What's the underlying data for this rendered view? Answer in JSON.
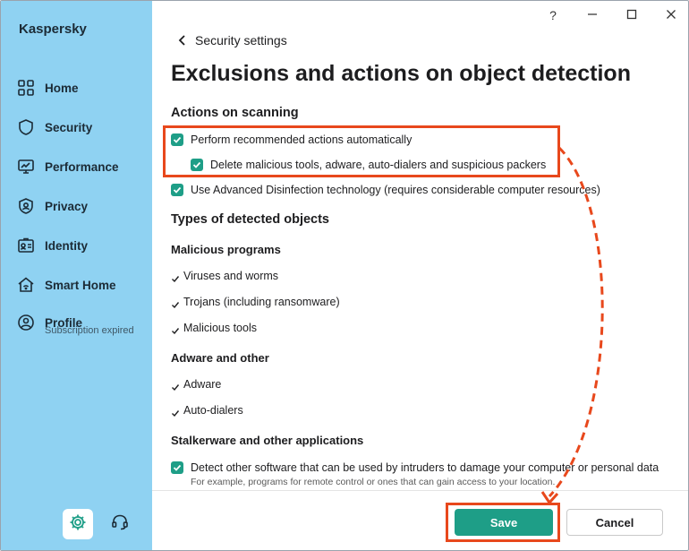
{
  "app": {
    "brand": "Kaspersky"
  },
  "window_controls": {
    "help": "?",
    "minimize": "—",
    "maximize": "☐",
    "close": "✕"
  },
  "sidebar": {
    "items": [
      {
        "label": "Home",
        "icon": "home-icon"
      },
      {
        "label": "Security",
        "icon": "shield-icon"
      },
      {
        "label": "Performance",
        "icon": "performance-icon"
      },
      {
        "label": "Privacy",
        "icon": "privacy-icon"
      },
      {
        "label": "Identity",
        "icon": "identity-icon"
      },
      {
        "label": "Smart Home",
        "icon": "smart-home-icon"
      },
      {
        "label": "Profile",
        "icon": "profile-icon",
        "sublabel": "Subscription expired"
      }
    ]
  },
  "header": {
    "back_label": "Security settings",
    "title": "Exclusions and actions on object detection"
  },
  "actions_on_scanning": {
    "title": "Actions on scanning",
    "options": [
      {
        "label": "Perform recommended actions automatically",
        "checked": true
      },
      {
        "label": "Delete malicious tools, adware, auto-dialers and suspicious packers",
        "checked": true
      },
      {
        "label": "Use Advanced Disinfection technology (requires considerable computer resources)",
        "checked": true
      }
    ]
  },
  "types": {
    "title": "Types of detected objects",
    "malicious": {
      "title": "Malicious programs",
      "items": [
        "Viruses and worms",
        "Trojans (including ransomware)",
        "Malicious tools"
      ]
    },
    "adware": {
      "title": "Adware and other",
      "items": [
        "Adware",
        "Auto-dialers"
      ]
    },
    "stalkerware": {
      "title": "Stalkerware and other applications",
      "option": "Detect other software that can be used by intruders to damage your computer or personal data",
      "hint": "For example, programs for remote control or ones that can gain access to your location."
    }
  },
  "footer": {
    "save_label": "Save",
    "cancel_label": "Cancel"
  },
  "colors": {
    "accent": "#1e9e87",
    "sidebar": "#8fd2f2",
    "highlight": "#e8481c"
  }
}
